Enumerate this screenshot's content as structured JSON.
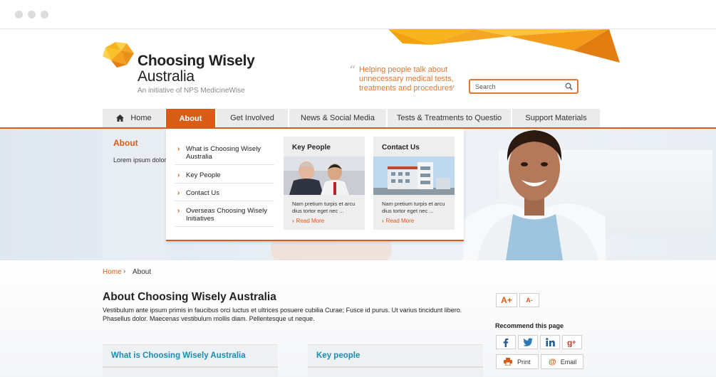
{
  "header": {
    "logo_title": "Choosing Wisely",
    "logo_subtitle": "Australia",
    "logo_tagline": "An initiative of NPS MedicineWise",
    "tagline": "Helping people talk about unnecessary medical tests, treatments and procedures",
    "search_placeholder": "Search"
  },
  "nav": {
    "items": [
      {
        "label": "Home"
      },
      {
        "label": "About"
      },
      {
        "label": "Get Involved"
      },
      {
        "label": "News & Social Media"
      },
      {
        "label": "Tests & Treatments to Questio"
      },
      {
        "label": "Support Materials"
      }
    ],
    "active": "About"
  },
  "hero": {
    "about_title": "About",
    "about_text": "Lorem ipsum dolor sit amet, consectetur adipiscing elit, sed do eiusmod tempor incididunt ut labore et dolore magna aliqua. Ut enim ad minim veniam, quis nostrud exercitation ullamco laboris nisi ut aliquip ex ea commodo consequat."
  },
  "dropdown": {
    "links": [
      {
        "label": "What is Choosing Wisely Australia"
      },
      {
        "label": "Key People"
      },
      {
        "label": "Contact Us"
      },
      {
        "label": "Overseas Choosing Wisely Initiatives"
      }
    ],
    "cards": [
      {
        "title": "Key People",
        "text": "Nam pretium turpis et arcu dius tortor eget nec ...",
        "more": "Read More"
      },
      {
        "title": "Contact Us",
        "text": "Nam pretium turpis et arcu dius tortor eget nec ...",
        "more": "Read More"
      }
    ]
  },
  "breadcrumb": {
    "home": "Home",
    "separator": "›",
    "current": "About"
  },
  "main": {
    "title": "About Choosing Wisely Australia",
    "intro": "Vestibulum ante ipsum primis in faucibus orci luctus et ultrices posuere cubilia Curae; Fusce id purus. Ut varius tincidunt libero. Phasellus dolor. Maecenas vestibulum mollis diam. Pellentesque ut neque.",
    "panels": [
      {
        "title": "What is Choosing Wisely Australia"
      },
      {
        "title": "Key people"
      }
    ]
  },
  "tools": {
    "font_larger": "A+",
    "font_smaller": "A-",
    "recommend_title": "Recommend this page",
    "social": [
      "facebook-icon",
      "twitter-icon",
      "linkedin-icon",
      "google-plus-icon"
    ],
    "print_label": "Print",
    "email_label": "Email"
  },
  "colors": {
    "accent": "#d95b18",
    "link_blue": "#1a8cb5",
    "tagline_orange": "#e0762f",
    "nav_grey": "#ebebeb"
  }
}
